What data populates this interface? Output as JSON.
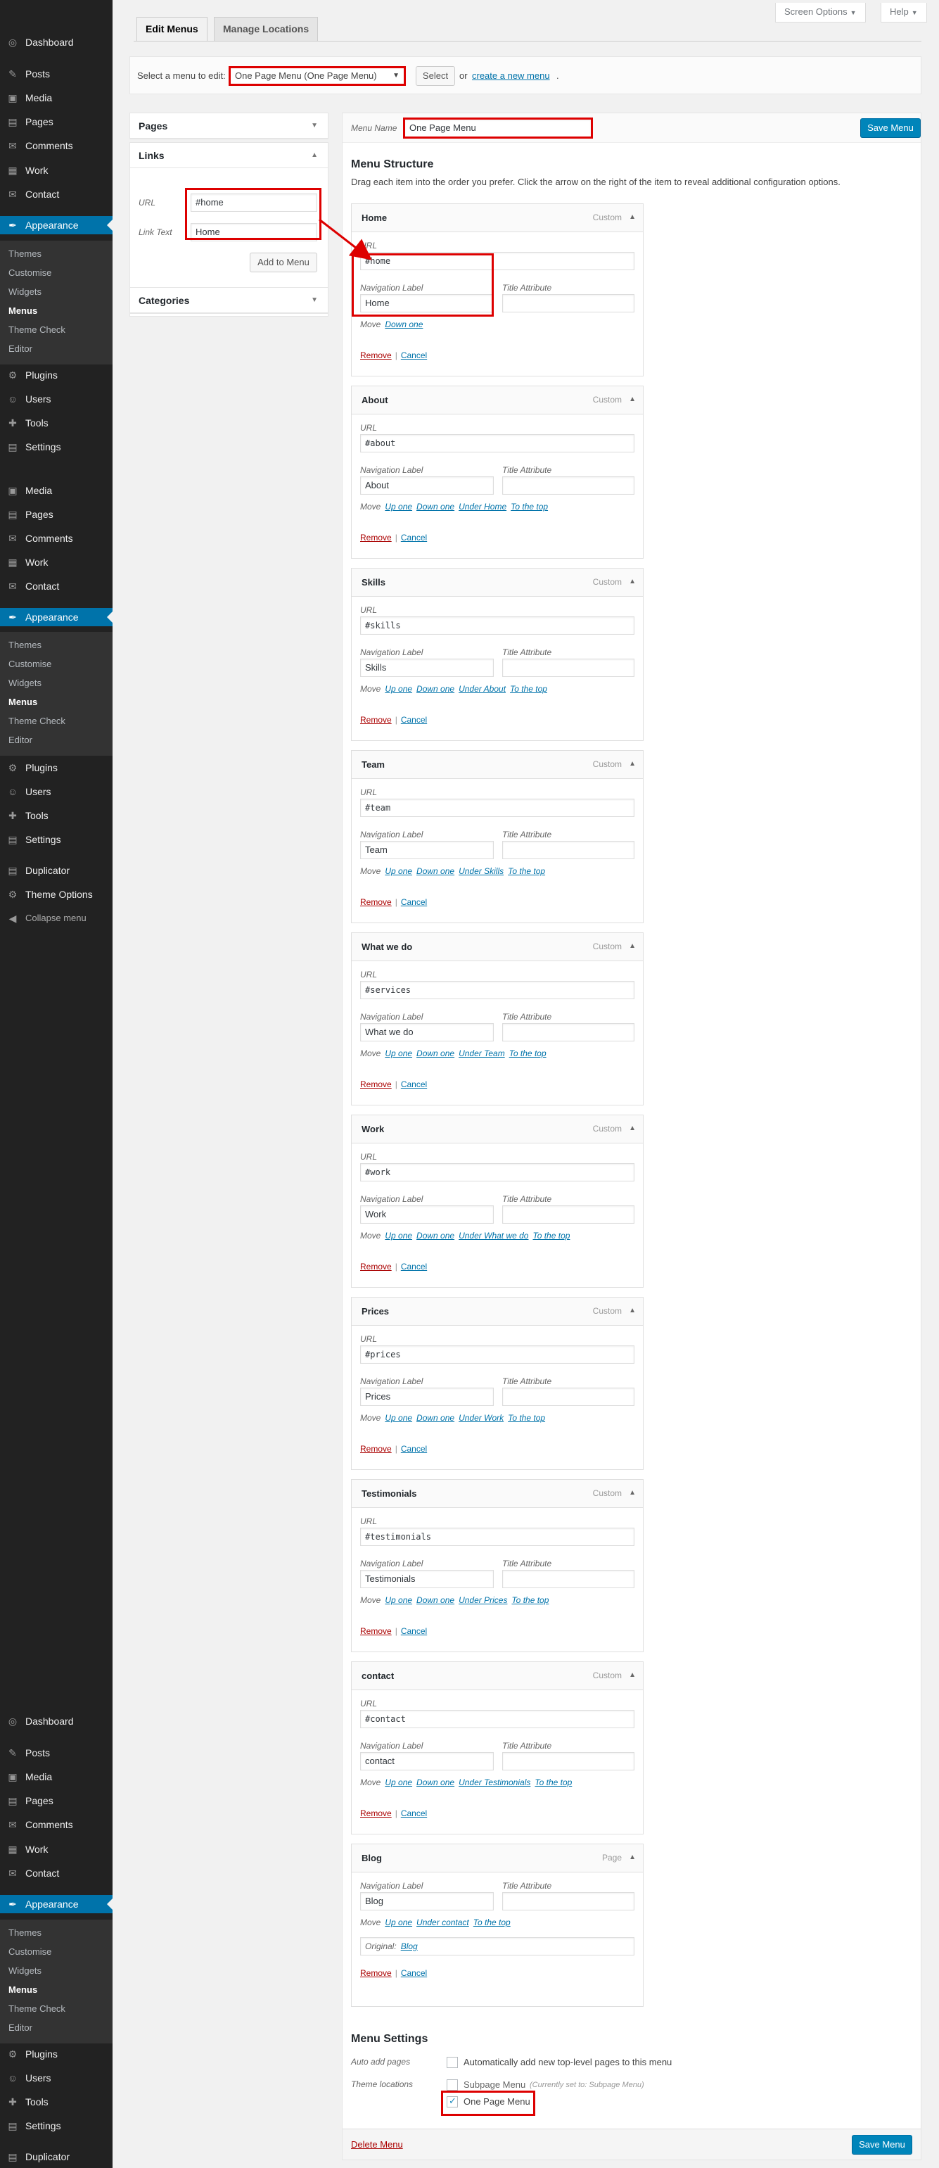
{
  "top": {
    "screen_options": "Screen Options",
    "help": "Help"
  },
  "tabs": [
    {
      "label": "Edit Menus"
    },
    {
      "label": "Manage Locations"
    }
  ],
  "manage": {
    "label": "Select a menu to edit:",
    "selected": "One Page Menu (One Page Menu)",
    "select_btn": "Select",
    "or_text": "or",
    "create_link": "create a new menu",
    "create_suffix": "."
  },
  "left": {
    "pages_title": "Pages",
    "links_title": "Links",
    "url_label": "URL",
    "url_value": "#home",
    "linktext_label": "Link Text",
    "linktext_value": "Home",
    "add_btn": "Add to Menu",
    "categories_title": "Categories"
  },
  "menu": {
    "name_label": "Menu Name",
    "name_value": "One Page Menu",
    "save_btn": "Save Menu",
    "structure_title": "Menu Structure",
    "structure_desc": "Drag each item into the order you prefer. Click the arrow on the right of the item to reveal additional configuration options.",
    "url_label": "URL",
    "nav_label": "Navigation Label",
    "title_attr_label": "Title Attribute",
    "move_label": "Move",
    "remove": "Remove",
    "cancel": "Cancel",
    "sep": "|",
    "items": [
      {
        "title": "Home",
        "type": "Custom",
        "url": "#home",
        "label": "Home",
        "moves": [
          "Down one"
        ]
      },
      {
        "title": "About",
        "type": "Custom",
        "url": "#about",
        "label": "About",
        "moves": [
          "Up one",
          "Down one",
          "Under Home",
          "To the top"
        ]
      },
      {
        "title": "Skills",
        "type": "Custom",
        "url": "#skills",
        "label": "Skills",
        "moves": [
          "Up one",
          "Down one",
          "Under About",
          "To the top"
        ]
      },
      {
        "title": "Team",
        "type": "Custom",
        "url": "#team",
        "label": "Team",
        "moves": [
          "Up one",
          "Down one",
          "Under Skills",
          "To the top"
        ]
      },
      {
        "title": "What we do",
        "type": "Custom",
        "url": "#services",
        "label": "What we do",
        "moves": [
          "Up one",
          "Down one",
          "Under Team",
          "To the top"
        ]
      },
      {
        "title": "Work",
        "type": "Custom",
        "url": "#work",
        "label": "Work",
        "moves": [
          "Up one",
          "Down one",
          "Under What we do",
          "To the top"
        ]
      },
      {
        "title": "Prices",
        "type": "Custom",
        "url": "#prices",
        "label": "Prices",
        "moves": [
          "Up one",
          "Down one",
          "Under Work",
          "To the top"
        ]
      },
      {
        "title": "Testimonials",
        "type": "Custom",
        "url": "#testimonials",
        "label": "Testimonials",
        "moves": [
          "Up one",
          "Down one",
          "Under Prices",
          "To the top"
        ]
      },
      {
        "title": "contact",
        "type": "Custom",
        "url": "#contact",
        "label": "contact",
        "moves": [
          "Up one",
          "Down one",
          "Under Testimonials",
          "To the top"
        ]
      }
    ],
    "blog": {
      "title": "Blog",
      "type": "Page",
      "label": "Blog",
      "moves": [
        "Up one",
        "Under contact",
        "To the top"
      ],
      "original_label": "Original:",
      "original_link": "Blog"
    },
    "settings_title": "Menu Settings",
    "auto_add_label": "Auto add pages",
    "auto_add_text": "Automatically add new top-level pages to this menu",
    "theme_loc_label": "Theme locations",
    "loc1": "Subpage Menu",
    "loc1_note": "(Currently set to: Subpage Menu)",
    "loc2": "One Page Menu",
    "delete": "Delete Menu"
  },
  "sidebar": {
    "g1": [
      {
        "icon": "◎",
        "label": "Dashboard"
      },
      {
        "icon": "✎",
        "label": "Posts"
      },
      {
        "icon": "▣",
        "label": "Media"
      },
      {
        "icon": "▤",
        "label": "Pages"
      },
      {
        "icon": "✉",
        "label": "Comments"
      },
      {
        "icon": "▦",
        "label": "Work"
      },
      {
        "icon": "✉",
        "label": "Contact"
      }
    ],
    "appearance": "Appearance",
    "sub": [
      "Themes",
      "Customise",
      "Widgets",
      "Menus",
      "Theme Check",
      "Editor"
    ],
    "g2": [
      {
        "icon": "⚙",
        "label": "Plugins"
      },
      {
        "icon": "☺",
        "label": "Users"
      },
      {
        "icon": "✚",
        "label": "Tools"
      },
      {
        "icon": "▤",
        "label": "Settings"
      }
    ],
    "g1b": [
      {
        "icon": "▣",
        "label": "Media"
      },
      {
        "icon": "▤",
        "label": "Pages"
      },
      {
        "icon": "✉",
        "label": "Comments"
      },
      {
        "icon": "▦",
        "label": "Work"
      },
      {
        "icon": "✉",
        "label": "Contact"
      }
    ],
    "g3": [
      {
        "icon": "▤",
        "label": "Duplicator"
      },
      {
        "icon": "⚙",
        "label": "Theme Options"
      }
    ],
    "collapse": "Collapse menu"
  }
}
